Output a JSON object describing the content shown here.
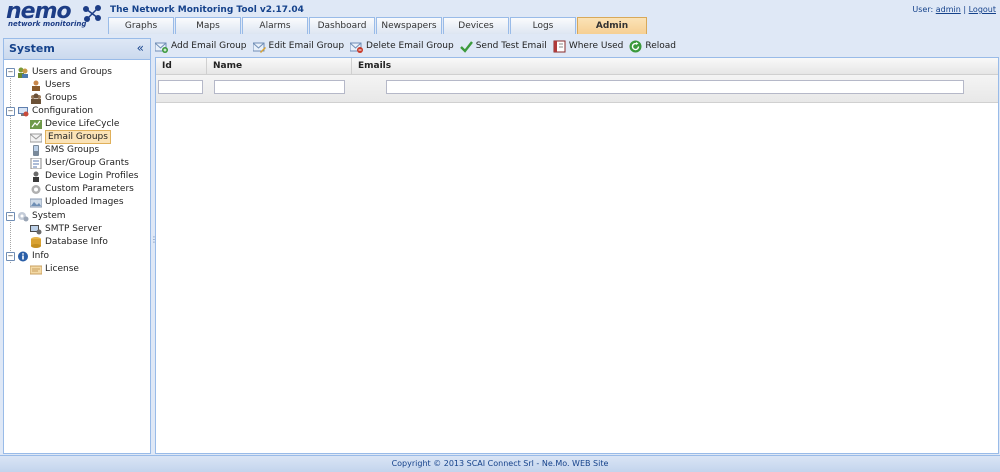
{
  "logo": {
    "main": "nemo",
    "sub": "network monitoring"
  },
  "app_title": "The Network Monitoring Tool v2.17.04",
  "user": {
    "label": "User:",
    "name": "admin",
    "sep": "|",
    "logout": "Logout"
  },
  "tabs": [
    {
      "label": "Graphs"
    },
    {
      "label": "Maps"
    },
    {
      "label": "Alarms"
    },
    {
      "label": "Dashboard"
    },
    {
      "label": "Newspapers"
    },
    {
      "label": "Devices"
    },
    {
      "label": "Logs"
    },
    {
      "label": "Admin",
      "active": true
    }
  ],
  "sidebar": {
    "title": "System",
    "collapse_icon": "double-chevron-left-icon",
    "tree": [
      {
        "label": "Users and Groups",
        "level": 0,
        "toggle": "−",
        "icon": "users-groups-icon"
      },
      {
        "label": "Users",
        "level": 1,
        "icon": "users-icon"
      },
      {
        "label": "Groups",
        "level": 1,
        "icon": "groups-icon"
      },
      {
        "label": "Configuration",
        "level": 0,
        "toggle": "−",
        "icon": "configuration-icon"
      },
      {
        "label": "Device LifeCycle",
        "level": 1,
        "icon": "device-lifecycle-icon"
      },
      {
        "label": "Email Groups",
        "level": 1,
        "icon": "email-groups-icon",
        "selected": true
      },
      {
        "label": "SMS Groups",
        "level": 1,
        "icon": "sms-groups-icon"
      },
      {
        "label": "User/Group Grants",
        "level": 1,
        "icon": "grants-icon"
      },
      {
        "label": "Device Login Profiles",
        "level": 1,
        "icon": "login-profiles-icon"
      },
      {
        "label": "Custom Parameters",
        "level": 1,
        "icon": "custom-parameters-icon"
      },
      {
        "label": "Uploaded Images",
        "level": 1,
        "icon": "uploaded-images-icon"
      },
      {
        "label": "System",
        "level": 0,
        "toggle": "−",
        "icon": "system-icon"
      },
      {
        "label": "SMTP Server",
        "level": 1,
        "icon": "smtp-server-icon"
      },
      {
        "label": "Database Info",
        "level": 1,
        "icon": "database-icon"
      },
      {
        "label": "Info",
        "level": 0,
        "toggle": "−",
        "icon": "info-icon"
      },
      {
        "label": "License",
        "level": 1,
        "icon": "license-icon"
      }
    ]
  },
  "toolbar": [
    {
      "label": "Add Email Group",
      "icon": "add-email-group-icon"
    },
    {
      "label": "Edit Email Group",
      "icon": "edit-email-group-icon"
    },
    {
      "label": "Delete Email Group",
      "icon": "delete-email-group-icon"
    },
    {
      "label": "Send Test Email",
      "icon": "check-icon"
    },
    {
      "label": "Where Used",
      "icon": "book-icon"
    },
    {
      "label": "Reload",
      "icon": "reload-icon"
    }
  ],
  "grid": {
    "columns": [
      "Id",
      "Name",
      "Emails"
    ],
    "filters": [
      "",
      "",
      ""
    ]
  },
  "footer": "Copyright © 2013 SCAI Connect Srl - Ne.Mo. WEB Site",
  "colors": {
    "accent": "#15428b",
    "active_tab": "#f6cf93",
    "border": "#99bbe8",
    "background": "#dfe8f6"
  }
}
